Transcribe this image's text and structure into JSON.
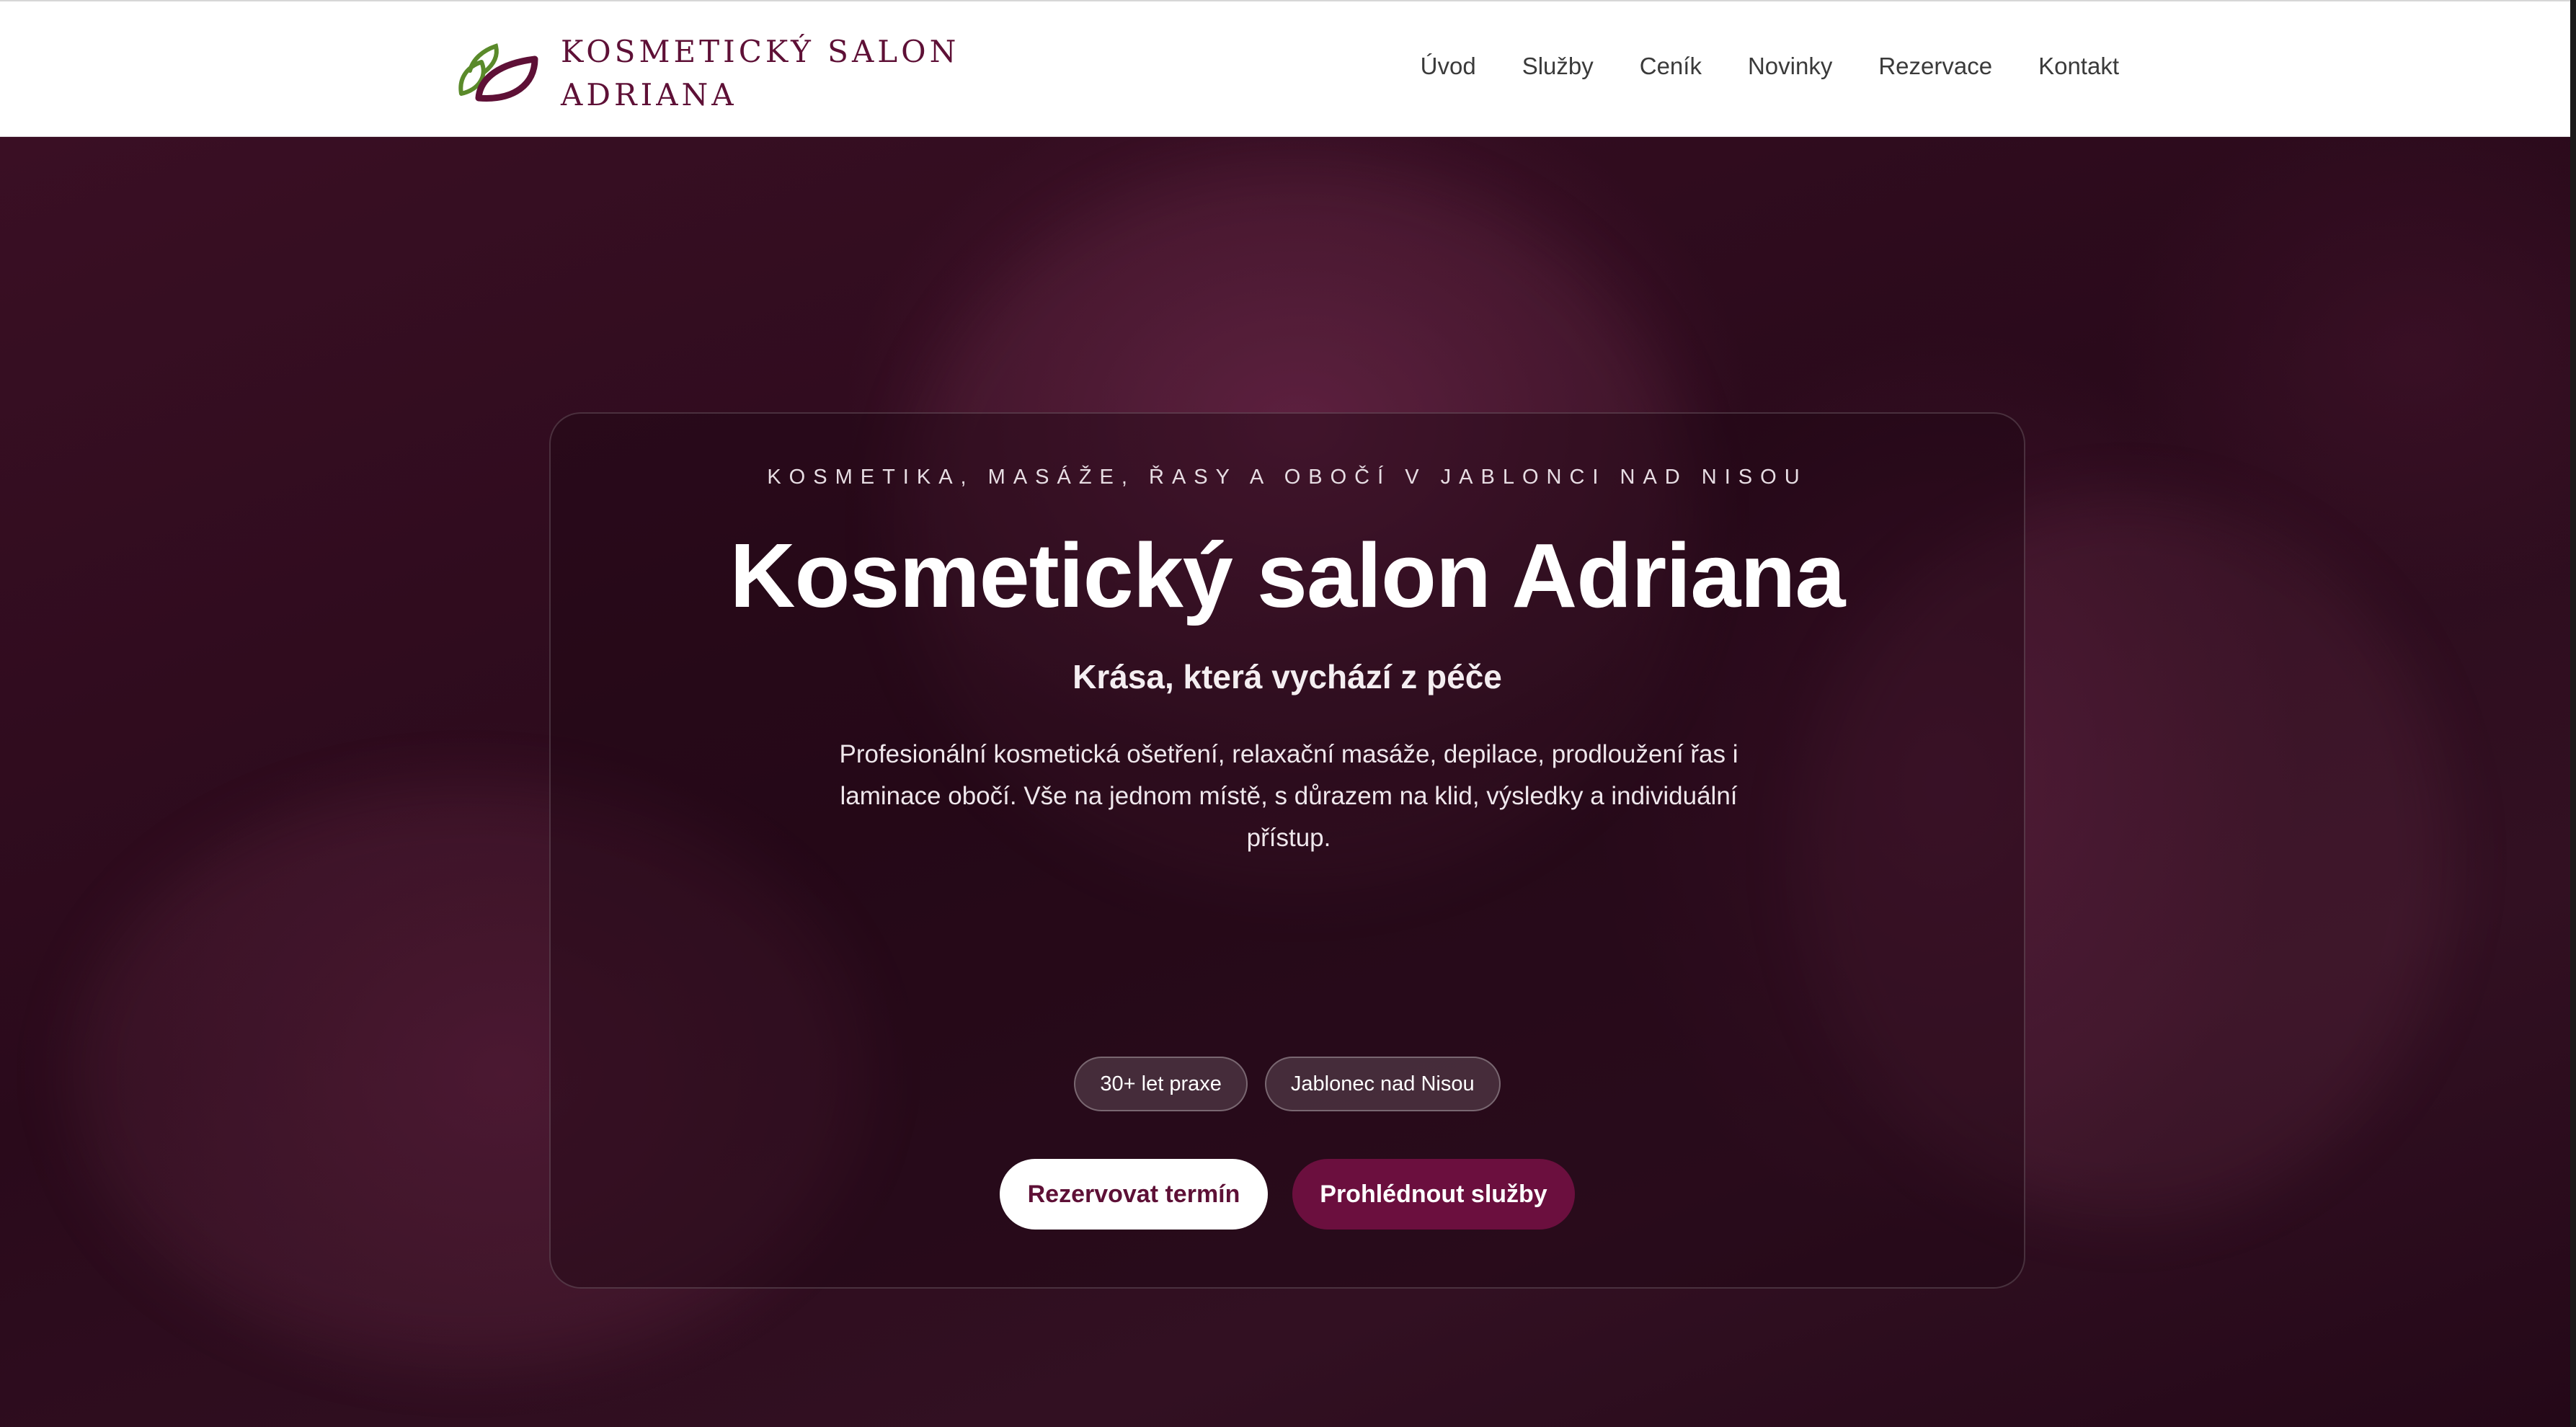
{
  "brand": {
    "name_line1": "KOSMETICKÝ SALON",
    "name_line2": "ADRIANA",
    "logo_icon": "leaf-logo-icon",
    "colors": {
      "primary": "#5e1036",
      "leaf_green": "#5a8a2a"
    }
  },
  "nav": {
    "items": [
      {
        "label": "Úvod"
      },
      {
        "label": "Služby"
      },
      {
        "label": "Ceník"
      },
      {
        "label": "Novinky"
      },
      {
        "label": "Rezervace"
      },
      {
        "label": "Kontakt"
      }
    ]
  },
  "hero": {
    "eyebrow": "KOSMETIKA, MASÁŽE, ŘASY A OBOČÍ V JABLONCI NAD NISOU",
    "title": "Kosmetický salon Adriana",
    "subtitle": "Krása, která vychází z péče",
    "description": "Profesionální kosmetická ošetření, relaxační masáže, depilace, prodloužení řas i laminace obočí. Vše na jednom místě, s důrazem na klid, výsledky a individuální přístup.",
    "badges": [
      {
        "label": "30+ let praxe"
      },
      {
        "label": "Jablonec nad Nisou"
      }
    ],
    "primary_button": "Rezervovat termín",
    "secondary_button": "Prohlédnout služby",
    "colors": {
      "secondary_button_bg": "#6b0f3e",
      "overlay": "#2a0a1b"
    }
  }
}
